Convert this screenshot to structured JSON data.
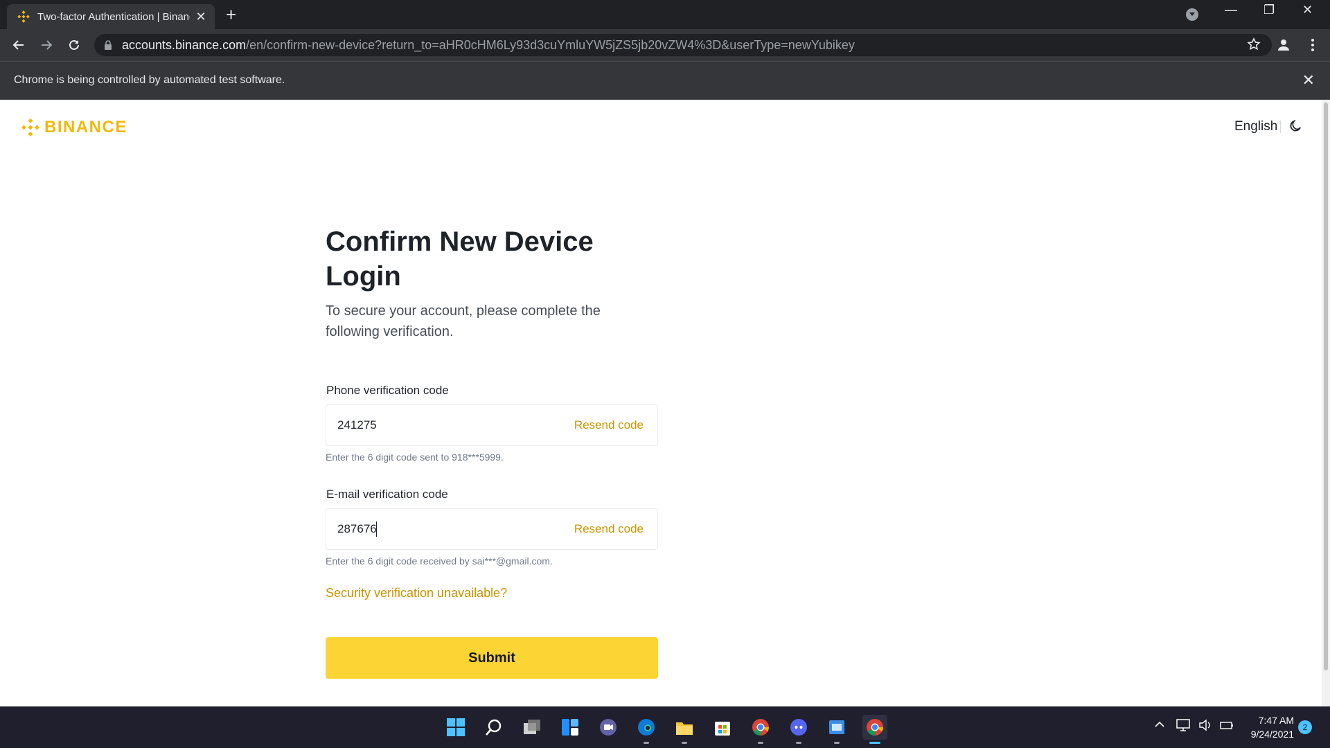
{
  "browser": {
    "tab_title": "Two-factor Authentication | Binance",
    "tab_close": "✕",
    "new_tab": "+",
    "url_host": "accounts.binance.com",
    "url_path": "/en/confirm-new-device?return_to=aHR0cHM6Ly93d3cuYmluYW5jZS5jb20vZW4%3D&userType=newYubikey",
    "infobar_text": "Chrome is being controlled by automated test software.",
    "infobar_close": "✕",
    "window_controls": {
      "minimize": "—",
      "restore": "❐",
      "close": "✕"
    }
  },
  "header": {
    "logo_text": "BINANCE",
    "language": "English",
    "brand_color": "#F0B90B"
  },
  "main": {
    "title": "Confirm New Device Login",
    "subtitle": "To secure your account, please complete the following verification.",
    "phone": {
      "label": "Phone verification code",
      "value": "241275",
      "resend": "Resend code",
      "hint": "Enter the 6 digit code sent to 918***5999."
    },
    "email": {
      "label": "E-mail verification code",
      "value": "287676",
      "resend": "Resend code",
      "hint": "Enter the 6 digit code received by sai***@gmail.com."
    },
    "unavailable_link": "Security verification unavailable?",
    "submit_label": "Submit",
    "button_color": "#FCD535",
    "link_color": "#C99400"
  },
  "taskbar": {
    "apps": [
      "start-icon",
      "search-icon",
      "task-view-icon",
      "widgets-icon",
      "teams-chat-icon",
      "edge-icon",
      "file-explorer-icon",
      "store-icon",
      "chrome-icon",
      "discord-icon",
      "app-icon",
      "chrome-active-icon"
    ],
    "time": "7:47 AM",
    "date": "9/24/2021",
    "notification_count": "2"
  }
}
